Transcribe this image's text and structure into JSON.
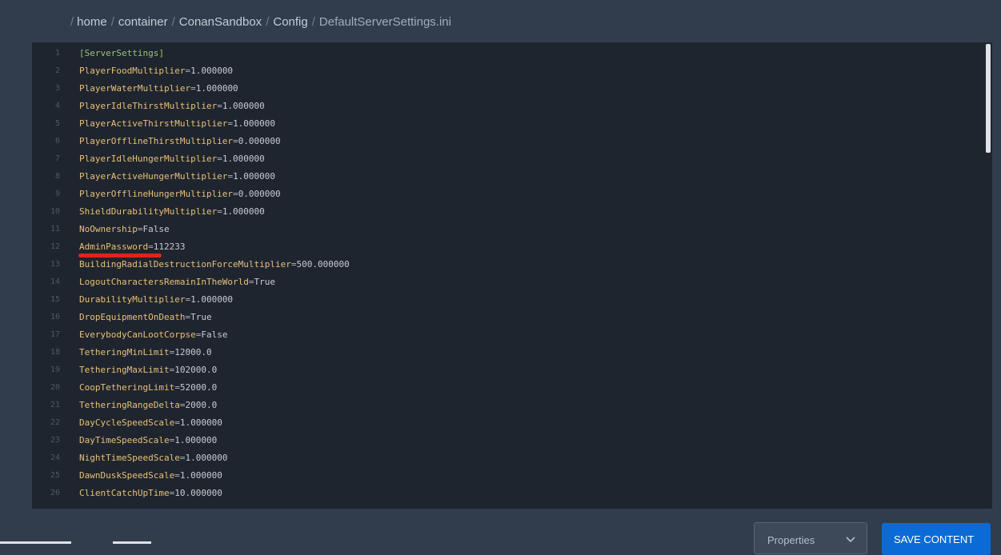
{
  "breadcrumb": {
    "separator": "/",
    "items": [
      "home",
      "container",
      "ConanSandbox",
      "Config",
      "DefaultServerSettings.ini"
    ]
  },
  "editor": {
    "section_header": "[ServerSettings]",
    "lines": [
      {
        "key": "PlayerFoodMultiplier",
        "value": "1.000000"
      },
      {
        "key": "PlayerWaterMultiplier",
        "value": "1.000000"
      },
      {
        "key": "PlayerIdleThirstMultiplier",
        "value": "1.000000"
      },
      {
        "key": "PlayerActiveThirstMultiplier",
        "value": "1.000000"
      },
      {
        "key": "PlayerOfflineThirstMultiplier",
        "value": "0.000000"
      },
      {
        "key": "PlayerIdleHungerMultiplier",
        "value": "1.000000"
      },
      {
        "key": "PlayerActiveHungerMultiplier",
        "value": "1.000000"
      },
      {
        "key": "PlayerOfflineHungerMultiplier",
        "value": "0.000000"
      },
      {
        "key": "ShieldDurabilityMultiplier",
        "value": "1.000000"
      },
      {
        "key": "NoOwnership",
        "value": "False"
      },
      {
        "key": "AdminPassword",
        "value": "112233"
      },
      {
        "key": "BuildingRadialDestructionForceMultiplier",
        "value": "500.000000"
      },
      {
        "key": "LogoutCharactersRemainInTheWorld",
        "value": "True"
      },
      {
        "key": "DurabilityMultiplier",
        "value": "1.000000"
      },
      {
        "key": "DropEquipmentOnDeath",
        "value": "True"
      },
      {
        "key": "EverybodyCanLootCorpse",
        "value": "False"
      },
      {
        "key": "TetheringMinLimit",
        "value": "12000.0"
      },
      {
        "key": "TetheringMaxLimit",
        "value": "102000.0"
      },
      {
        "key": "CoopTetheringLimit",
        "value": "52000.0"
      },
      {
        "key": "TetheringRangeDelta",
        "value": "2000.0"
      },
      {
        "key": "DayCycleSpeedScale",
        "value": "1.000000"
      },
      {
        "key": "DayTimeSpeedScale",
        "value": "1.000000"
      },
      {
        "key": "NightTimeSpeedScale",
        "value": "1.000000"
      },
      {
        "key": "DawnDuskSpeedScale",
        "value": "1.000000"
      },
      {
        "key": "ClientCatchUpTime",
        "value": "10.000000"
      }
    ]
  },
  "actions": {
    "properties_label": "Properties",
    "save_label": "SAVE CONTENT"
  },
  "colors": {
    "background": "#313d4c",
    "editor_background": "#1f252e",
    "key_color": "#e6c07b",
    "section_color": "#98c379",
    "highlight": "#e2231a",
    "save_button": "#0b6bd6"
  }
}
